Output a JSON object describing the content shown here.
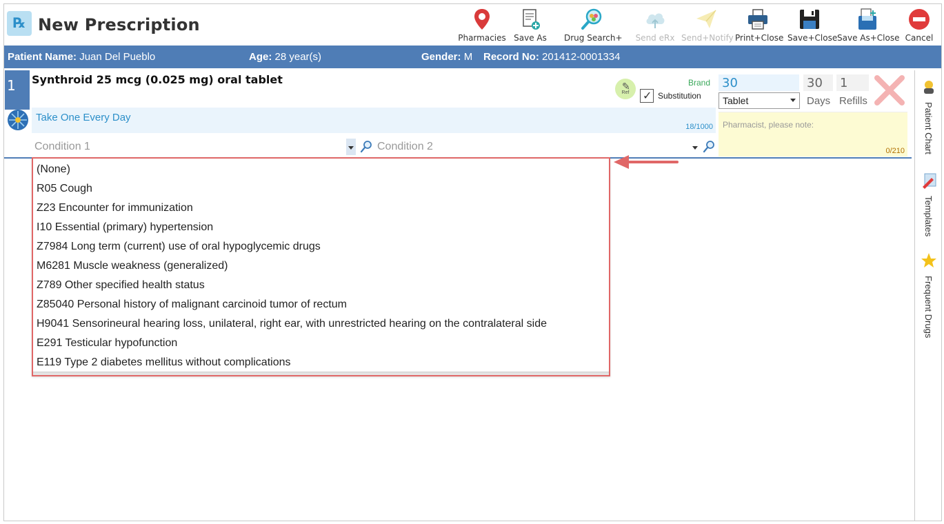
{
  "window": {
    "title": "New Prescription"
  },
  "toolbar": {
    "pharmacies": "Pharmacies",
    "save_as": "Save As",
    "drug_search": "Drug Search+",
    "send_erx": "Send eRx",
    "send_notify": "Send+Notify",
    "print_close": "Print+Close",
    "save_close": "Save+Close",
    "save_as_close": "Save As+Close",
    "cancel": "Cancel"
  },
  "patient": {
    "name_label": "Patient Name:",
    "name": "Juan Del Pueblo",
    "age_label": "Age:",
    "age": "28 year(s)",
    "gender_label": "Gender:",
    "gender": "M",
    "record_label": "Record No:",
    "record_no": "201412-0001334"
  },
  "prescription": {
    "number": "1",
    "drug": "Synthroid 25 mcg (0.025 mg) oral tablet",
    "ref_badge": "Ref",
    "brand_label": "Brand",
    "substitution_label": "Substitution",
    "substitution_checked": true,
    "quantity": "30",
    "unit": "Tablet",
    "days": "30",
    "days_label": "Days",
    "refills": "1",
    "refills_label": "Refills",
    "sig": "Take One Every Day",
    "sig_count": "18/1000",
    "pharmacist_note_placeholder": "Pharmacist, please note:",
    "pharmacist_note_count": "0/210",
    "condition1_placeholder": "Condition 1",
    "condition2_placeholder": "Condition 2"
  },
  "conditions_dropdown": [
    "(None)",
    "R05 Cough",
    "Z23 Encounter for immunization",
    "I10 Essential (primary) hypertension",
    "Z7984 Long term (current) use of oral hypoglycemic drugs",
    "M6281 Muscle weakness (generalized)",
    "Z789 Other specified health status",
    "Z85040 Personal history of malignant carcinoid tumor of rectum",
    "H9041 Sensorineural hearing loss, unilateral, right ear, with unrestricted hearing on the contralateral side",
    "E291 Testicular hypofunction",
    "E119 Type 2 diabetes mellitus without complications"
  ],
  "side_panel": {
    "patient_chart": "Patient Chart",
    "templates": "Templates",
    "frequent_drugs": "Frequent Drugs"
  },
  "colors": {
    "patient_bar": "#4f7db6",
    "accent_blue": "#2c8fc9",
    "highlight_border": "#e06767",
    "brand_green": "#3aa85a",
    "note_bg": "#fdfbd3"
  },
  "icons": {
    "pharmacies": "map-pin-icon",
    "save_as": "document-plus-icon",
    "drug_search": "magnifier-pills-icon",
    "send_erx": "cloud-upload-icon",
    "send_notify": "paper-plane-icon",
    "print_close": "printer-icon",
    "save_close": "floppy-disk-icon",
    "save_as_close": "floppy-stack-icon",
    "cancel": "no-entry-icon"
  }
}
